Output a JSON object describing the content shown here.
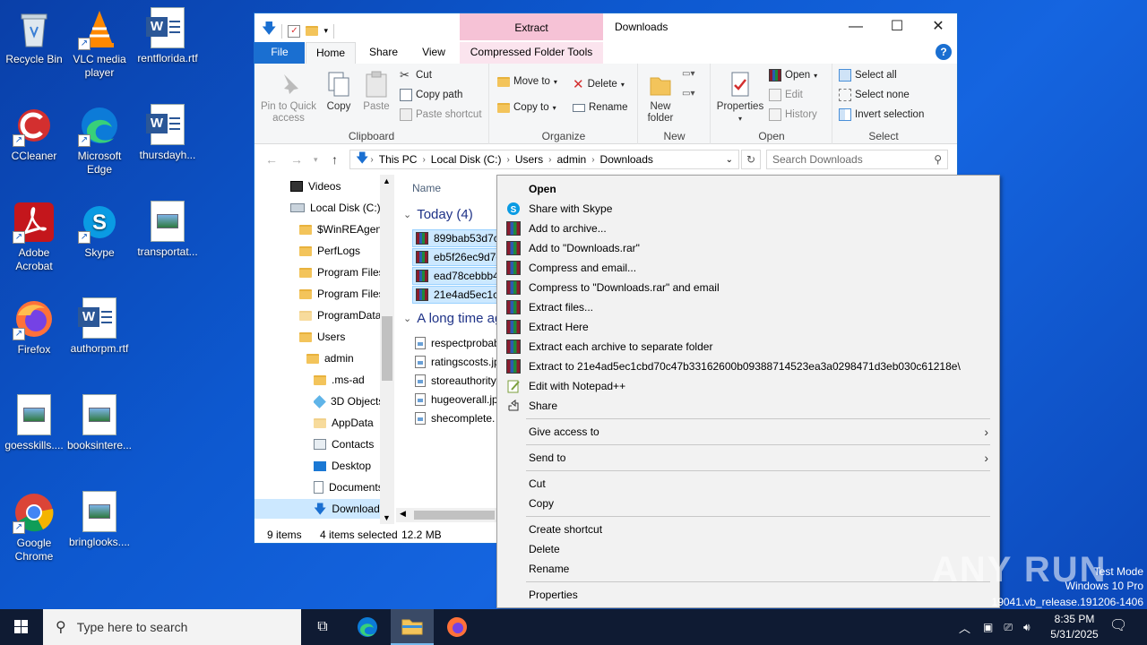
{
  "desktop": {
    "icons": [
      {
        "label": "Recycle Bin"
      },
      {
        "label": "VLC media player"
      },
      {
        "label": "rentflorida.rtf"
      },
      {
        "label": "CCleaner"
      },
      {
        "label": "Microsoft Edge"
      },
      {
        "label": "thursdayh..."
      },
      {
        "label": "Adobe Acrobat"
      },
      {
        "label": "Skype"
      },
      {
        "label": "transportat..."
      },
      {
        "label": "Firefox"
      },
      {
        "label": "authorpm.rtf"
      },
      {
        "label": "goesskills...."
      },
      {
        "label": "booksintere..."
      },
      {
        "label": "Google Chrome"
      },
      {
        "label": "bringlooks...."
      }
    ]
  },
  "explorer": {
    "context_tab_top": "Extract",
    "title": "Downloads",
    "tabs": {
      "file": "File",
      "home": "Home",
      "share": "Share",
      "view": "View",
      "context": "Compressed Folder Tools"
    },
    "ribbon": {
      "clipboard": {
        "label": "Clipboard",
        "pin": "Pin to Quick access",
        "copy": "Copy",
        "paste": "Paste",
        "cut": "Cut",
        "copy_path": "Copy path",
        "paste_shortcut": "Paste shortcut"
      },
      "organize": {
        "label": "Organize",
        "move_to": "Move to",
        "copy_to": "Copy to",
        "delete": "Delete",
        "rename": "Rename"
      },
      "new": {
        "label": "New",
        "new_folder": "New folder"
      },
      "open": {
        "label": "Open",
        "properties": "Properties",
        "open": "Open",
        "edit": "Edit",
        "history": "History"
      },
      "select": {
        "label": "Select",
        "select_all": "Select all",
        "select_none": "Select none",
        "invert": "Invert selection"
      }
    },
    "address": {
      "crumbs": [
        "This PC",
        "Local Disk (C:)",
        "Users",
        "admin",
        "Downloads"
      ],
      "search_placeholder": "Search Downloads"
    },
    "nav": [
      {
        "label": "Videos"
      },
      {
        "label": "Local Disk (C:)"
      },
      {
        "label": "$WinREAgent"
      },
      {
        "label": "PerfLogs"
      },
      {
        "label": "Program Files"
      },
      {
        "label": "Program Files"
      },
      {
        "label": "ProgramData"
      },
      {
        "label": "Users"
      },
      {
        "label": "admin"
      },
      {
        "label": ".ms-ad"
      },
      {
        "label": "3D Objects"
      },
      {
        "label": "AppData"
      },
      {
        "label": "Contacts"
      },
      {
        "label": "Desktop"
      },
      {
        "label": "Documents"
      },
      {
        "label": "Downloads"
      }
    ],
    "column_name": "Name",
    "groups": {
      "today": "Today (4)",
      "long_ago": "A long time ago"
    },
    "today_files": [
      "899bab53d7c9",
      "eb5f26ec9d7e",
      "ead78cebbb4c",
      "21e4ad5ec1cb"
    ],
    "old_files": [
      "respectprobab",
      "ratingscosts.jp",
      "storeauthority",
      "hugeoverall.jp",
      "shecomplete."
    ],
    "status": {
      "items": "9 items",
      "selected": "4 items selected",
      "size": "12.2 MB"
    }
  },
  "context_menu": {
    "items": [
      "Open",
      "Share with Skype",
      "Add to archive...",
      "Add to \"Downloads.rar\"",
      "Compress and email...",
      "Compress to \"Downloads.rar\" and email",
      "Extract files...",
      "Extract Here",
      "Extract each archive to separate folder",
      "Extract to 21e4ad5ec1cbd70c47b33162600b09388714523ea3a0298471d3eb030c61218e\\",
      "Edit with Notepad++",
      "Share",
      "Give access to",
      "Send to",
      "Cut",
      "Copy",
      "Create shortcut",
      "Delete",
      "Rename",
      "Properties"
    ]
  },
  "taskbar": {
    "search_placeholder": "Type here to search",
    "time": "8:35 PM",
    "date": "5/31/2025"
  },
  "watermark": {
    "brand": "ANY RUN",
    "test_mode": "Test Mode",
    "os": "Windows 10 Pro",
    "build": "19041.vb_release.191206-1406"
  }
}
